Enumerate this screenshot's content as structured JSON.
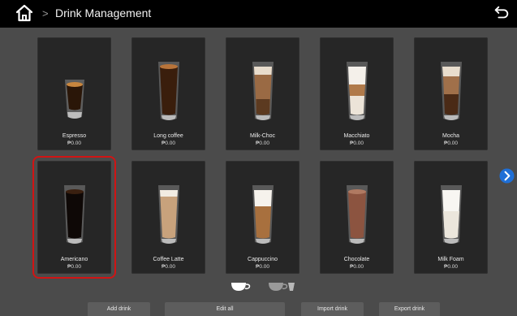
{
  "header": {
    "title": "Drink Management",
    "separator": ">"
  },
  "drinks": [
    {
      "name": "Espresso",
      "price": "₱0.00"
    },
    {
      "name": "Long coffee",
      "price": "₱0.00"
    },
    {
      "name": "Milk-Choc",
      "price": "₱0.00"
    },
    {
      "name": "Macchiato",
      "price": "₱0.00"
    },
    {
      "name": "Mocha",
      "price": "₱0.00"
    },
    {
      "name": "Americano",
      "price": "₱0.00"
    },
    {
      "name": "Coffee Latte",
      "price": "₱0.00"
    },
    {
      "name": "Cappuccino",
      "price": "₱0.00"
    },
    {
      "name": "Chocolate",
      "price": "₱0.00"
    },
    {
      "name": "Milk Foam",
      "price": "₱0.00"
    }
  ],
  "selected_drink": "Americano",
  "pager": {
    "current_page": 1,
    "total_pages": 2
  },
  "buttons": {
    "add": "Add drink",
    "edit_all": "Edit all",
    "import": "Import drink",
    "export": "Export drink"
  },
  "colors": {
    "accent": "#1f6fd6",
    "selection": "#d11414"
  },
  "icons": {
    "home": "home-icon",
    "back": "back-icon",
    "next": "chevron-right-icon"
  }
}
